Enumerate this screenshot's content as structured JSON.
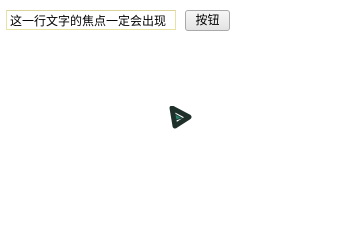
{
  "form": {
    "input_value": "这一行文字的焦点一定会出现",
    "button_label": "按钮"
  },
  "cursor": {
    "icon": "busy-cursor-icon"
  },
  "colors": {
    "background": "#ffffff",
    "input_border": "#e7e3a3",
    "cursor_outer": "#1f2f2a",
    "cursor_inner": "#2e7f6a"
  }
}
